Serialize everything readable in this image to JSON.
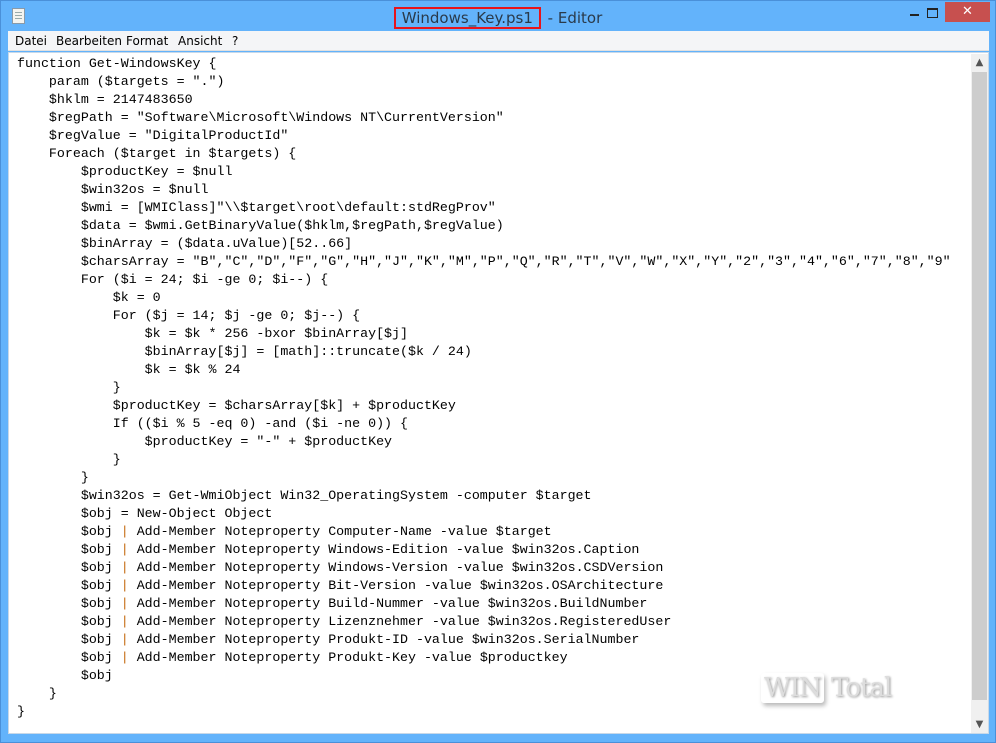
{
  "window": {
    "title_file": "Windows_Key.ps1",
    "title_sep": " - ",
    "title_app": "Editor",
    "close_glyph": "✕"
  },
  "menu": [
    "Datei",
    "Bearbeiten",
    "Format",
    "Ansicht",
    "?"
  ],
  "colors": {
    "titlebar": "#63b3fb",
    "close": "#c7504f",
    "highlight_box": "#e8141a",
    "pipe": "#c56a10"
  },
  "watermark": "WIN Total",
  "scrollbar": {
    "up": "▲",
    "down": "▼"
  },
  "lines": [
    "function Get-WindowsKey {",
    "    param ($targets = \".\")",
    "    $hklm = 2147483650",
    "    $regPath = \"Software\\Microsoft\\Windows NT\\CurrentVersion\"",
    "    $regValue = \"DigitalProductId\"",
    "    Foreach ($target in $targets) {",
    "        $productKey = $null",
    "        $win32os = $null",
    "        $wmi = [WMIClass]\"\\\\$target\\root\\default:stdRegProv\"",
    "        $data = $wmi.GetBinaryValue($hklm,$regPath,$regValue)",
    "        $binArray = ($data.uValue)[52..66]",
    "        $charsArray = \"B\",\"C\",\"D\",\"F\",\"G\",\"H\",\"J\",\"K\",\"M\",\"P\",\"Q\",\"R\",\"T\",\"V\",\"W\",\"X\",\"Y\",\"2\",\"3\",\"4\",\"6\",\"7\",\"8\",\"9\"",
    "        For ($i = 24; $i -ge 0; $i--) {",
    "            $k = 0",
    "            For ($j = 14; $j -ge 0; $j--) {",
    "                $k = $k * 256 -bxor $binArray[$j]",
    "                $binArray[$j] = [math]::truncate($k / 24)",
    "                $k = $k % 24",
    "            }",
    "            $productKey = $charsArray[$k] + $productKey",
    "            If (($i % 5 -eq 0) -and ($i -ne 0)) {",
    "                $productKey = \"-\" + $productKey",
    "            }",
    "        }",
    "        $win32os = Get-WmiObject Win32_OperatingSystem -computer $target",
    "        $obj = New-Object Object",
    "        $obj | Add-Member Noteproperty Computer-Name -value $target",
    "        $obj | Add-Member Noteproperty Windows-Edition -value $win32os.Caption",
    "        $obj | Add-Member Noteproperty Windows-Version -value $win32os.CSDVersion",
    "        $obj | Add-Member Noteproperty Bit-Version -value $win32os.OSArchitecture",
    "        $obj | Add-Member Noteproperty Build-Nummer -value $win32os.BuildNumber",
    "        $obj | Add-Member Noteproperty Lizenznehmer -value $win32os.RegisteredUser",
    "        $obj | Add-Member Noteproperty Produkt-ID -value $win32os.SerialNumber",
    "        $obj | Add-Member Noteproperty Produkt-Key -value $productkey",
    "        $obj",
    "    }",
    "}"
  ]
}
